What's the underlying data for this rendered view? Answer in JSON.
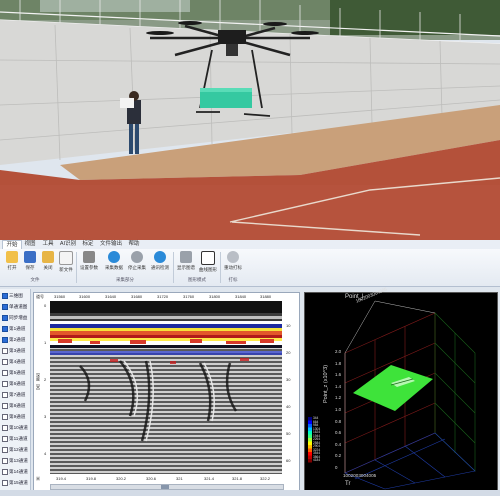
{
  "menu": {
    "tabs": [
      "开始",
      "视图",
      "工具",
      "AI识别",
      "标定",
      "文件输出",
      "帮助"
    ]
  },
  "ribbon": {
    "groups": [
      {
        "name": "文件",
        "buttons": [
          {
            "label": "打开",
            "icon": "folder-open-icon"
          },
          {
            "label": "保存",
            "icon": "save-icon"
          },
          {
            "label": "关闭",
            "icon": "close-folder-icon"
          },
          {
            "label": "新文件",
            "icon": "new-file-icon"
          }
        ]
      },
      {
        "name": "采集部分",
        "buttons": [
          {
            "label": "设置参数",
            "icon": "settings-icon"
          },
          {
            "label": "采集数据",
            "icon": "play-icon"
          },
          {
            "label": "停止采集",
            "icon": "stop-icon"
          },
          {
            "label": "通讯检测",
            "icon": "wifi-icon"
          }
        ]
      },
      {
        "name": "图形模式",
        "buttons": [
          {
            "label": "显示图谱",
            "icon": "image-icon"
          },
          {
            "label": "曲线图形",
            "icon": "waveform-icon"
          }
        ]
      },
      {
        "name": "打标",
        "buttons": [
          {
            "label": "重动打标",
            "icon": "info-icon"
          }
        ]
      }
    ]
  },
  "sidebar": {
    "items": [
      {
        "label": "三维图",
        "checked": true
      },
      {
        "label": "单通道图",
        "checked": true
      },
      {
        "label": "同步增益",
        "checked": true
      },
      {
        "label": "第1通道",
        "checked": true
      },
      {
        "label": "第2通道",
        "checked": true
      },
      {
        "label": "第3通道",
        "checked": false
      },
      {
        "label": "第4通道",
        "checked": false
      },
      {
        "label": "第5通道",
        "checked": false
      },
      {
        "label": "第6通道",
        "checked": false
      },
      {
        "label": "第7通道",
        "checked": false
      },
      {
        "label": "第8通道",
        "checked": false
      },
      {
        "label": "第9通道",
        "checked": false
      },
      {
        "label": "第10通道",
        "checked": false
      },
      {
        "label": "第11通道",
        "checked": false
      },
      {
        "label": "第12通道",
        "checked": false
      },
      {
        "label": "第13通道",
        "checked": false
      },
      {
        "label": "第14通道",
        "checked": false
      },
      {
        "label": "第15通道",
        "checked": false
      }
    ]
  },
  "radar": {
    "top_label": "道号",
    "top_ticks": [
      "31560",
      "31600",
      "31640",
      "31680",
      "31720",
      "31760",
      "31800",
      "31840",
      "31880"
    ],
    "bottom_label": "米",
    "bottom_ticks": [
      "319.4",
      "319.8",
      "320.2",
      "320.6",
      "321",
      "321.4",
      "321.8",
      "322.2"
    ],
    "left_label": "深度（米）",
    "left_ticks": [
      "0",
      "1",
      "2",
      "3",
      "4"
    ],
    "right_ticks": [
      "10",
      "20",
      "30",
      "40",
      "50",
      "60"
    ]
  },
  "plot3d": {
    "top_axis_label": "Point_l",
    "top_axis_ticks": "1002003004005",
    "z_label": "Point_z (x10^3)",
    "z_ticks": [
      "2.0",
      "1.8",
      "1.6",
      "1.4",
      "1.2",
      "1.0",
      "0.8",
      "0.6",
      "0.4",
      "0.2",
      "0"
    ],
    "bottom_axis_label": "Tr",
    "bottom_axis_ticks": "1002003004005",
    "legend": [
      "344",
      "664",
      "984",
      "1304",
      "1624",
      "1944",
      "2264",
      "2584",
      "2904",
      "3224",
      "3544",
      "3864",
      "4184"
    ]
  }
}
